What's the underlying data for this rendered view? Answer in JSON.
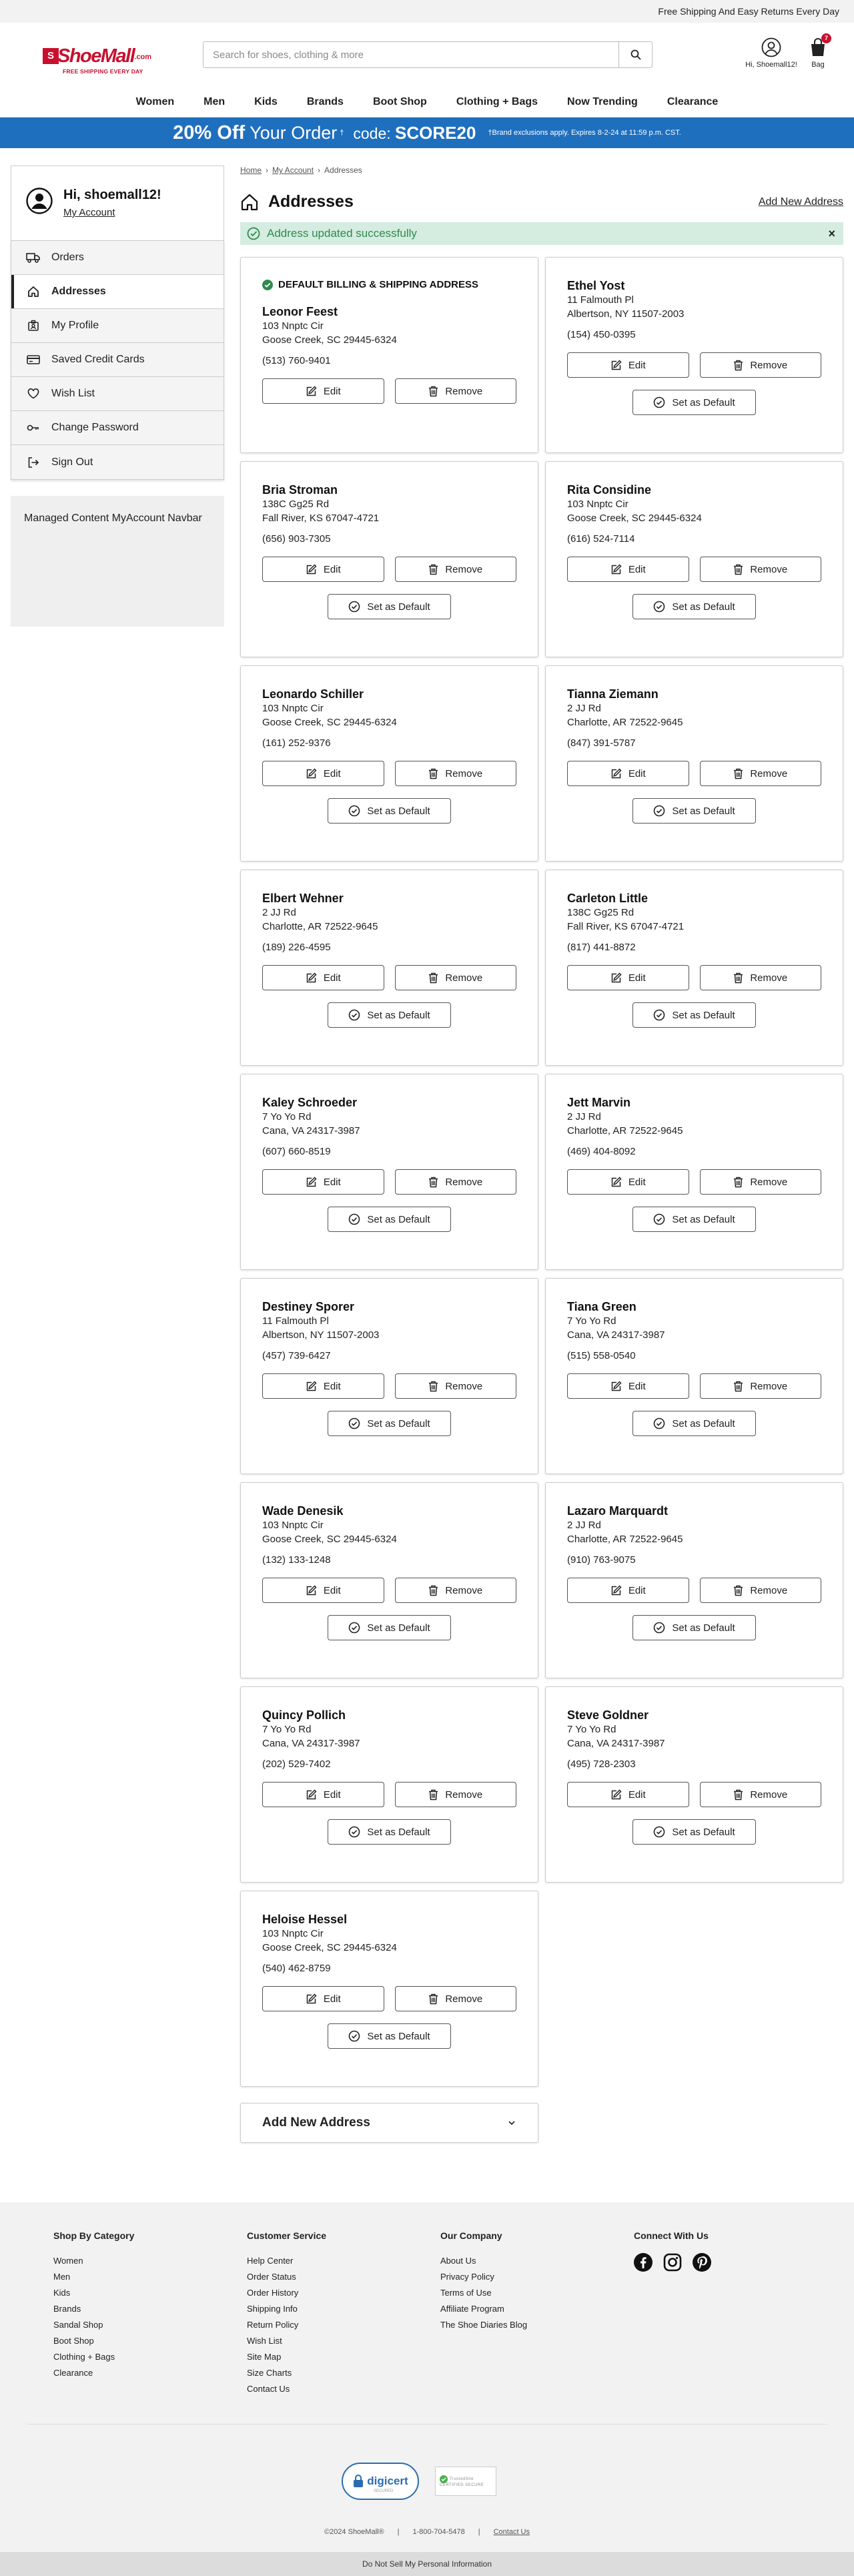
{
  "topbar": {
    "text": "Free Shipping And Easy Returns Every Day"
  },
  "logo": {
    "name": "ShoeMall",
    "suffix": ".com",
    "tagline": "FREE SHIPPING EVERY DAY"
  },
  "search": {
    "placeholder": "Search for shoes, clothing & more"
  },
  "header": {
    "user_label": "Hi, Shoemall12!",
    "bag_label": "Bag",
    "bag_count": "7"
  },
  "nav": [
    "Women",
    "Men",
    "Kids",
    "Brands",
    "Boot Shop",
    "Clothing + Bags",
    "Now Trending",
    "Clearance"
  ],
  "promo": {
    "main": "20% Off",
    "main_rest": " Your Order",
    "sup": "†",
    "code_label": "code:",
    "code": "SCORE20",
    "fine": "†Brand exclusions apply. Expires 8-2-24 at 11:59 p.m. CST."
  },
  "sidebar": {
    "greeting": "Hi, shoemall12!",
    "my_account": "My Account",
    "items": [
      {
        "label": "Orders",
        "icon": "truck-icon"
      },
      {
        "label": "Addresses",
        "icon": "home-icon",
        "active": true
      },
      {
        "label": "My Profile",
        "icon": "profile-card-icon"
      },
      {
        "label": "Saved Credit Cards",
        "icon": "credit-card-icon"
      },
      {
        "label": "Wish List",
        "icon": "heart-icon"
      },
      {
        "label": "Change Password",
        "icon": "key-icon"
      },
      {
        "label": "Sign Out",
        "icon": "sign-out-icon"
      }
    ],
    "managed": "Managed Content MyAccount Navbar"
  },
  "breadcrumb": {
    "home": "Home",
    "account": "My Account",
    "current": "Addresses"
  },
  "page": {
    "title": "Addresses",
    "add_link": "Add New Address"
  },
  "alert": {
    "message": "Address updated successfully",
    "close": "×"
  },
  "default_label": "DEFAULT BILLING & SHIPPING ADDRESS",
  "buttons": {
    "edit": "Edit",
    "remove": "Remove",
    "set_default": "Set as Default"
  },
  "addresses": [
    {
      "name": "Leonor Feest",
      "line1": "103 Nnptc Cir",
      "line2": "Goose Creek, SC 29445-6324",
      "phone": "(513) 760-9401",
      "is_default": true
    },
    {
      "name": "Ethel Yost",
      "line1": "11 Falmouth Pl",
      "line2": "Albertson, NY 11507-2003",
      "phone": "(154) 450-0395"
    },
    {
      "name": "Bria Stroman",
      "line1": "138C Gg25 Rd",
      "line2": "Fall River, KS 67047-4721",
      "phone": "(656) 903-7305"
    },
    {
      "name": "Rita Considine",
      "line1": "103 Nnptc Cir",
      "line2": "Goose Creek, SC 29445-6324",
      "phone": "(616) 524-7114"
    },
    {
      "name": "Leonardo Schiller",
      "line1": "103 Nnptc Cir",
      "line2": "Goose Creek, SC 29445-6324",
      "phone": "(161) 252-9376"
    },
    {
      "name": "Tianna Ziemann",
      "line1": "2 JJ Rd",
      "line2": "Charlotte, AR 72522-9645",
      "phone": "(847) 391-5787"
    },
    {
      "name": "Elbert Wehner",
      "line1": "2 JJ Rd",
      "line2": "Charlotte, AR 72522-9645",
      "phone": "(189) 226-4595"
    },
    {
      "name": "Carleton Little",
      "line1": "138C Gg25 Rd",
      "line2": "Fall River, KS 67047-4721",
      "phone": "(817) 441-8872"
    },
    {
      "name": "Kaley Schroeder",
      "line1": "7 Yo Yo Rd",
      "line2": "Cana, VA 24317-3987",
      "phone": "(607) 660-8519"
    },
    {
      "name": "Jett Marvin",
      "line1": "2 JJ Rd",
      "line2": "Charlotte, AR 72522-9645",
      "phone": "(469) 404-8092"
    },
    {
      "name": "Destiney Sporer",
      "line1": "11 Falmouth Pl",
      "line2": "Albertson, NY 11507-2003",
      "phone": "(457) 739-6427"
    },
    {
      "name": "Tiana Green",
      "line1": "7 Yo Yo Rd",
      "line2": "Cana, VA 24317-3987",
      "phone": "(515) 558-0540"
    },
    {
      "name": "Wade Denesik",
      "line1": "103 Nnptc Cir",
      "line2": "Goose Creek, SC 29445-6324",
      "phone": "(132) 133-1248"
    },
    {
      "name": "Lazaro Marquardt",
      "line1": "2 JJ Rd",
      "line2": "Charlotte, AR 72522-9645",
      "phone": "(910) 763-9075"
    },
    {
      "name": "Quincy Pollich",
      "line1": "7 Yo Yo Rd",
      "line2": "Cana, VA 24317-3987",
      "phone": "(202) 529-7402"
    },
    {
      "name": "Steve Goldner",
      "line1": "7 Yo Yo Rd",
      "line2": "Cana, VA 24317-3987",
      "phone": "(495) 728-2303"
    },
    {
      "name": "Heloise Hessel",
      "line1": "103 Nnptc Cir",
      "line2": "Goose Creek, SC 29445-6324",
      "phone": "(540) 462-8759"
    }
  ],
  "add_new": {
    "label": "Add New Address"
  },
  "footer": {
    "columns": [
      {
        "title": "Shop By Category",
        "links": [
          "Women",
          "Men",
          "Kids",
          "Brands",
          "Sandal Shop",
          "Boot Shop",
          "Clothing + Bags",
          "Clearance"
        ]
      },
      {
        "title": "Customer Service",
        "links": [
          "Help Center",
          "Order Status",
          "Order History",
          "Shipping Info",
          "Return Policy",
          "Wish List",
          "Site Map",
          "Size Charts",
          "Contact Us"
        ]
      },
      {
        "title": "Our Company",
        "links": [
          "About Us",
          "Privacy Policy",
          "Terms of Use",
          "Affiliate Program",
          "The Shoe Diaries Blog"
        ]
      }
    ],
    "connect_title": "Connect With Us",
    "social_icons": [
      "facebook-icon",
      "instagram-icon",
      "pinterest-icon"
    ],
    "digicert": "digicert",
    "digicert_sub": "SECURED",
    "trusted": "TrustedSite",
    "trusted_sub": "CERTIFIED SECURE",
    "copyright": "©2024 ShoeMall®",
    "phone": "1-800-704-5478",
    "contact": "Contact Us",
    "do_not_sell": "Do Not Sell My Personal Information"
  },
  "colors": {
    "brand_red": "#c8102e",
    "promo_blue": "#1f6fbf",
    "success_bg": "#d4ede0",
    "success_text": "#2f8a4e"
  }
}
